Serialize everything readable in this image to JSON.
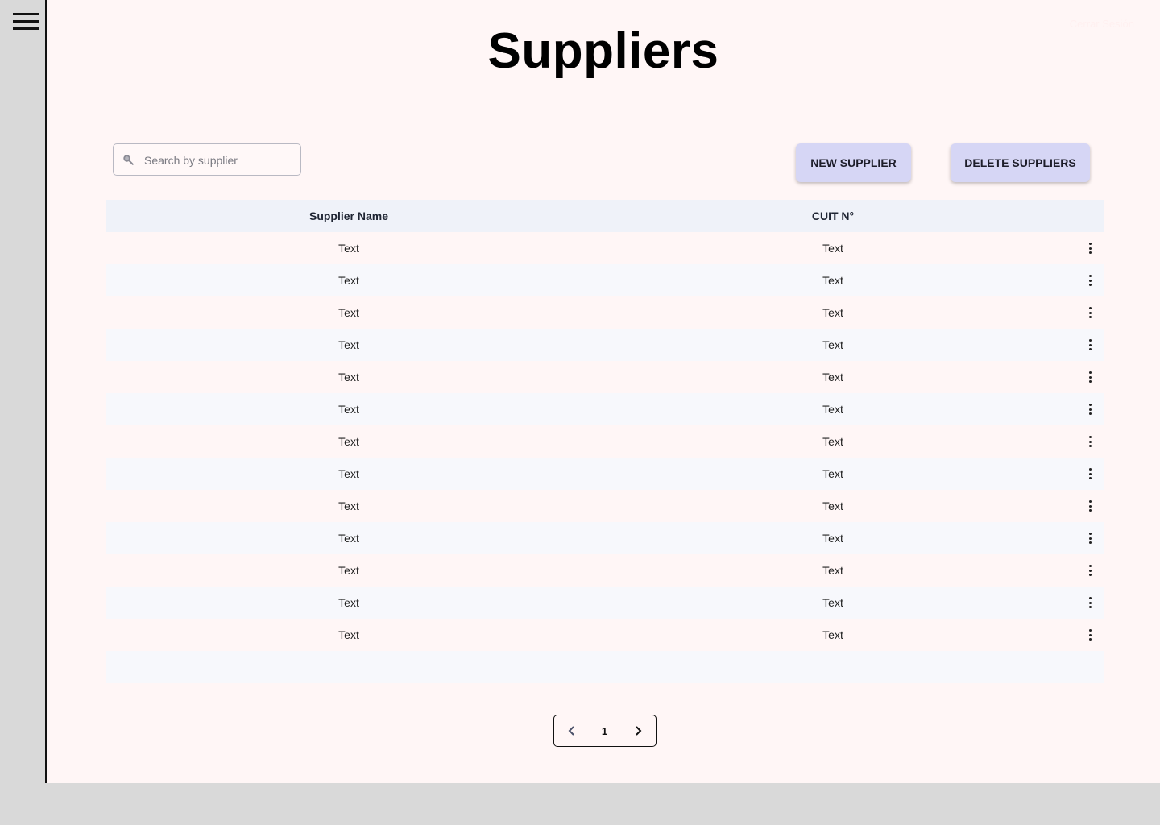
{
  "page": {
    "title": "Suppliers",
    "top_right_text": "Cerrar Sesión"
  },
  "search": {
    "placeholder": "Search by supplier",
    "icon": "search-icon"
  },
  "toolbar": {
    "new_label": "NEW SUPPLIER",
    "delete_label": "DELETE SUPPLIERS"
  },
  "table": {
    "columns": [
      "Supplier Name",
      "CUIT N°"
    ],
    "rows": [
      [
        "Text",
        "Text"
      ],
      [
        "Text",
        "Text"
      ],
      [
        "Text",
        "Text"
      ],
      [
        "Text",
        "Text"
      ],
      [
        "Text",
        "Text"
      ],
      [
        "Text",
        "Text"
      ],
      [
        "Text",
        "Text"
      ],
      [
        "Text",
        "Text"
      ],
      [
        "Text",
        "Text"
      ],
      [
        "Text",
        "Text"
      ],
      [
        "Text",
        "Text"
      ],
      [
        "Text",
        "Text"
      ],
      [
        "Text",
        "Text"
      ]
    ]
  },
  "pagination": {
    "current_page": "1"
  },
  "colors": {
    "page_background": "#fff6f6",
    "sidebar_background": "#d9d9d9",
    "button_background": "#d6d6f5",
    "table_header_background": "#eff2f9"
  }
}
